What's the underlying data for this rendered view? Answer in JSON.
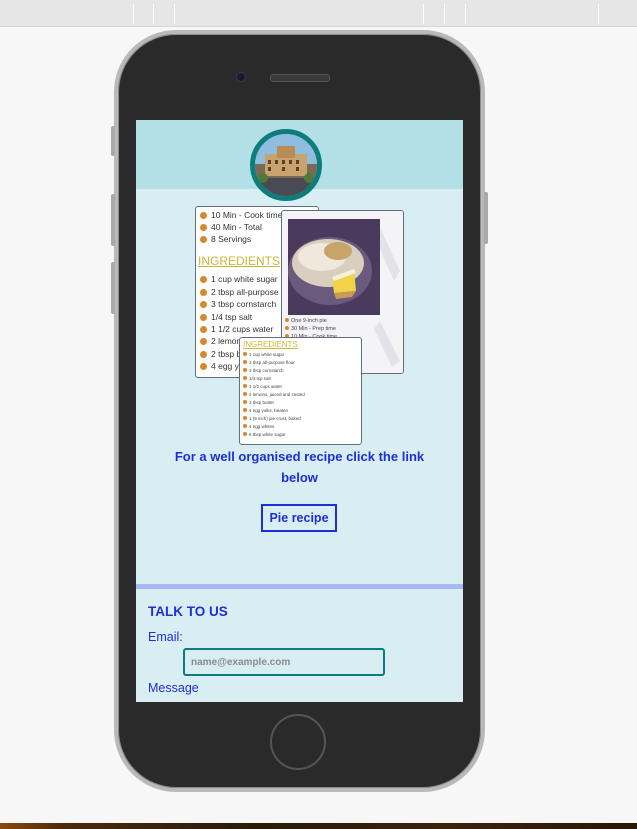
{
  "recipe_card_back": {
    "lines": [
      "10 Min - Cook time",
      "40 Min - Total",
      "8 Servings"
    ],
    "ingredients_title": "INGREDIENTS",
    "ingredients": [
      "1 cup white sugar",
      "2 tbsp all-purpose f",
      "3 tbsp cornstarch",
      "1/4 tsp salt",
      "1 1/2 cups water",
      "2 lemon",
      "2 tbsp b",
      "4 egg yo"
    ]
  },
  "recipe_card_photo": {
    "lines": [
      "One 9-inch pie",
      "30 Min - Prep time",
      "10 Min - Cook time"
    ]
  },
  "recipe_card_front": {
    "ingredients_title": "INGREDIENTS",
    "ingredients": [
      "1 cup white sugar",
      "2 tbsp all-purpose flour",
      "3 tbsp cornstarch",
      "1/4 tsp salt",
      "1 1/2 cups water",
      "2 lemons, juiced and zested",
      "2 tbsp butter",
      "4 egg yolks, beaten",
      "1 (9 inch) pie crust, baked",
      "4 egg whites",
      "6 tbsp white sugar"
    ]
  },
  "cta_text": "For a well organised recipe click the link below",
  "pie_button_label": "Pie recipe",
  "contact": {
    "heading": "TALK TO US",
    "email_label": "Email:",
    "email_placeholder": "name@example.com",
    "message_label": "Message"
  },
  "colors": {
    "accent_blue": "#1d2fd6",
    "teal_border": "#0c7d7b",
    "screen_bg": "#d9eef3",
    "header_bg": "#b2e0e6",
    "divider": "#a6b8f2"
  }
}
